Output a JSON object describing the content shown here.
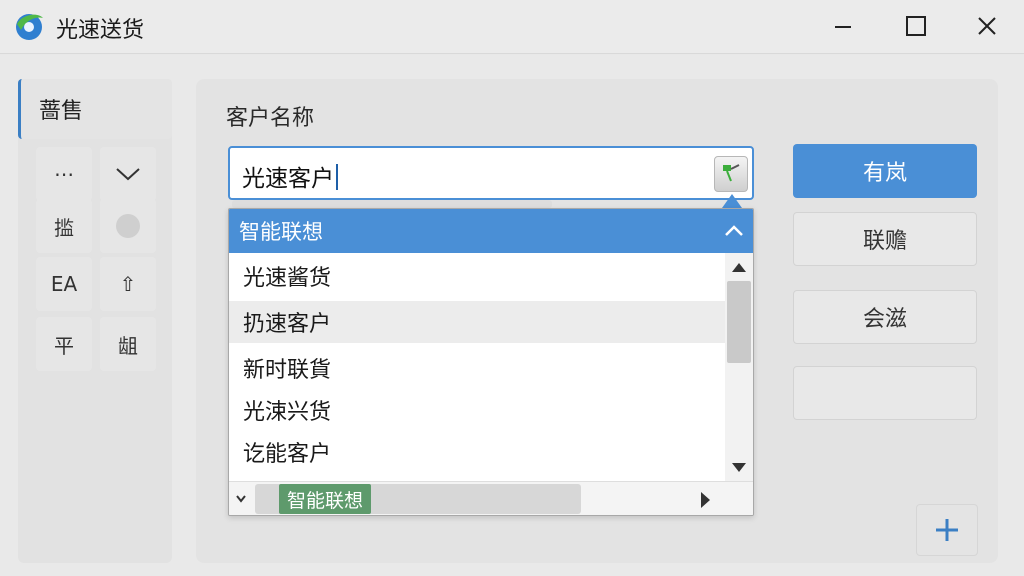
{
  "app": {
    "title": "光速送货"
  },
  "sidebar": {
    "active": "蔷售",
    "cells": [
      "⋯",
      "⌄",
      "㨫",
      "",
      "EA",
      "⇧",
      "平",
      "龃"
    ]
  },
  "form": {
    "label": "客户名称",
    "value": "光速客户"
  },
  "dropdown": {
    "header": "智能联想",
    "items": [
      "光速酱货",
      "扔速客户",
      "新时联貨",
      "光涑兴货",
      "讫能客户"
    ],
    "footer_badge": "智能联想"
  },
  "buttons": {
    "primary": "有岚",
    "second": "联赡",
    "third": "会滋",
    "fourth": ""
  },
  "colors": {
    "accent": "#4a8fd6",
    "badge": "#5e9a6c"
  }
}
